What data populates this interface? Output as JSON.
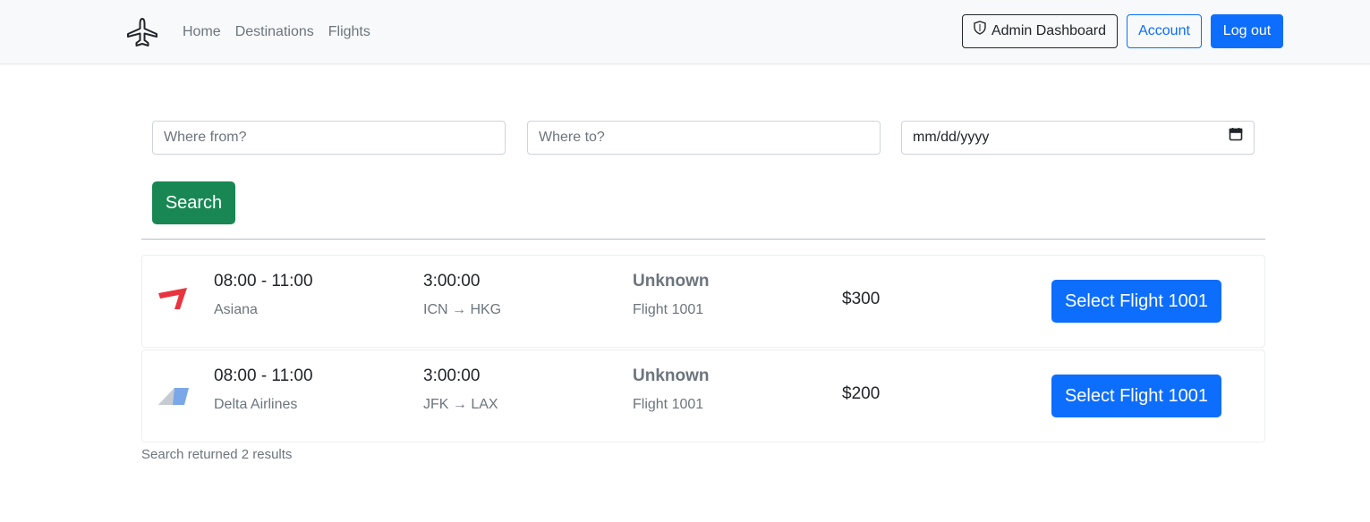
{
  "nav": {
    "brand_icon": "airplane-icon",
    "links": [
      "Home",
      "Destinations",
      "Flights"
    ],
    "admin_label": "Admin Dashboard",
    "admin_icon": "shield-icon",
    "account_label": "Account",
    "logout_label": "Log out"
  },
  "search": {
    "from_placeholder": "Where from?",
    "to_placeholder": "Where to?",
    "date_placeholder": "mm/dd/yyyy",
    "date_icon": "calendar-icon",
    "button_label": "Search"
  },
  "flights": [
    {
      "times": "08:00 - 11:00",
      "airline": "Asiana",
      "duration": "3:00:00",
      "route": "ICN → HKG",
      "status": "Unknown",
      "flight_no": "Flight 1001",
      "price": "$300",
      "select_label": "Select Flight 1001",
      "logo_icon": "asiana-logo-icon",
      "logo_color": "#e8343f"
    },
    {
      "times": "08:00 - 11:00",
      "airline": "Delta Airlines",
      "duration": "3:00:00",
      "route": "JFK → LAX",
      "status": "Unknown",
      "flight_no": "Flight 1001",
      "price": "$200",
      "select_label": "Select Flight 1001",
      "logo_icon": "delta-logo-icon",
      "logo_color": "#7aa7e8"
    }
  ],
  "results_text": "Search returned 2 results",
  "colors": {
    "primary": "#0d6efd",
    "success": "#198754",
    "muted": "#6c757d",
    "navbar_bg": "#f8f9fa"
  }
}
